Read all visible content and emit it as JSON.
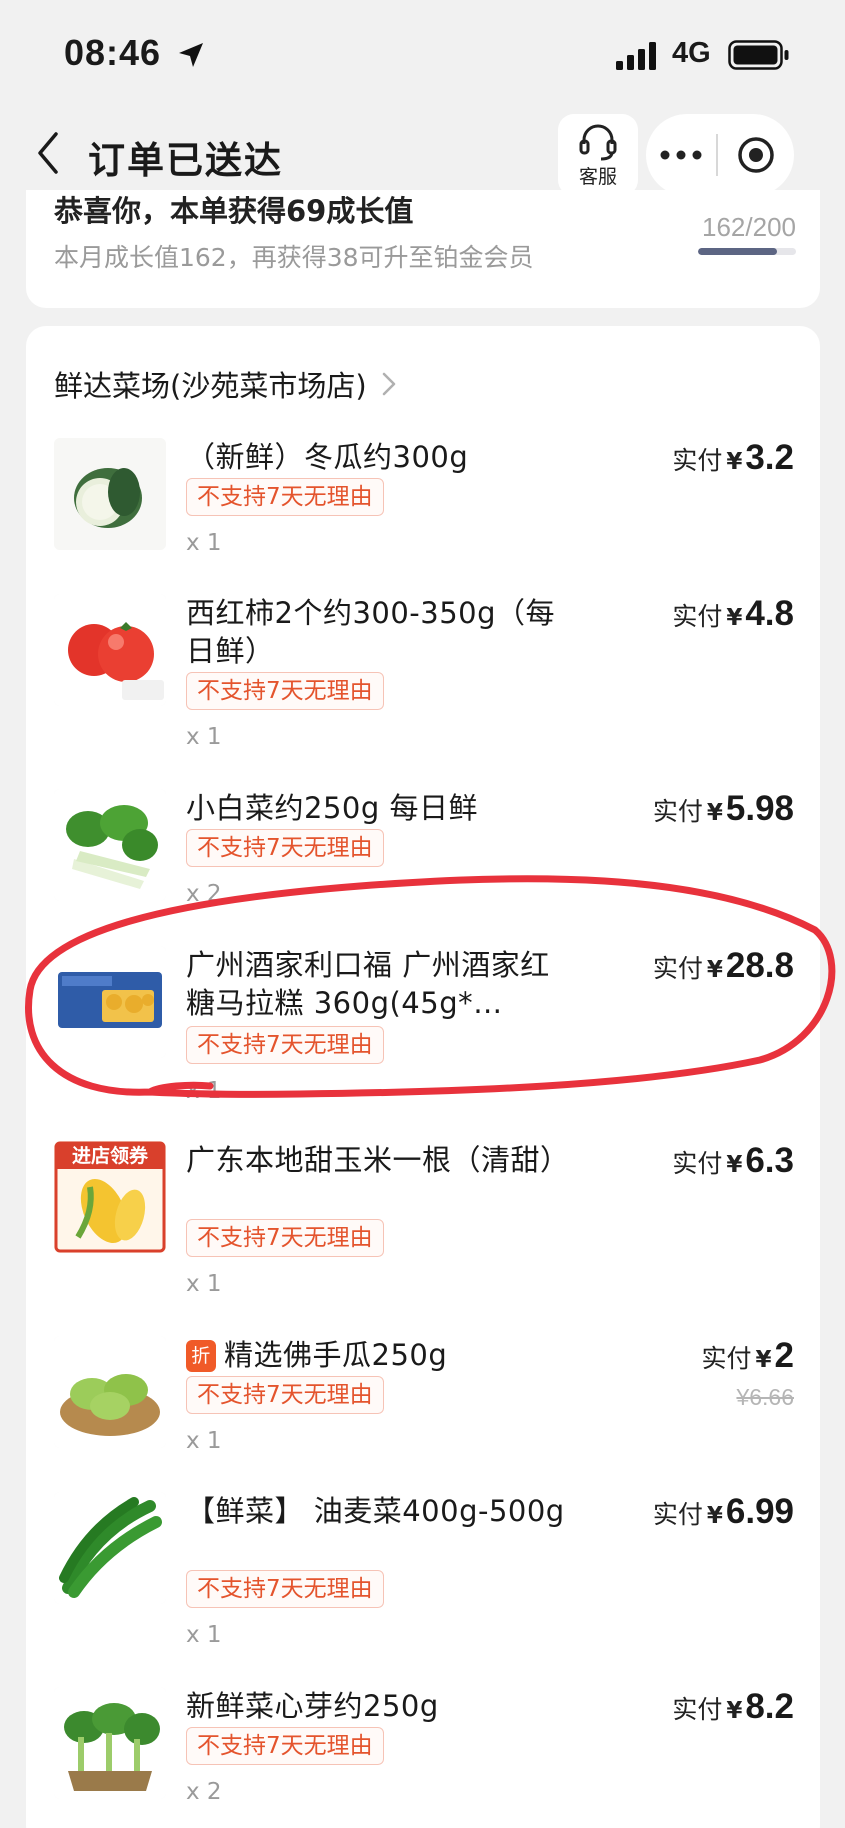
{
  "status_bar": {
    "time": "08:46",
    "network": "4G"
  },
  "nav": {
    "title": "订单已送达",
    "service_label": "客服"
  },
  "growth": {
    "headline": "恭喜你，本单获得69成长值",
    "subtext": "本月成长值162，再获得38可升至铂金会员",
    "progress_text": "162/200",
    "progress_fraction": 0.81
  },
  "shop": {
    "name": "鲜达菜场(沙苑菜市场店)"
  },
  "labels": {
    "paid": "实付",
    "currency": "¥",
    "no_return": "不支持7天无理由",
    "promo": "折"
  },
  "items": [
    {
      "title": "（新鲜）冬瓜约300g",
      "qty": "x 1",
      "price": "3.2",
      "image": "winter-melon"
    },
    {
      "title": "西红柿2个约300-350g（每日鲜）",
      "qty": "x 1",
      "price": "4.8",
      "image": "tomato"
    },
    {
      "title": "小白菜约250g 每日鲜",
      "qty": "x 2",
      "price": "5.98",
      "image": "bok-choy"
    },
    {
      "title": "广州酒家利口福 广州酒家红糖马拉糕 360g(45g*…",
      "qty": "x 1",
      "price": "28.8",
      "image": "sponge-cake-pack"
    },
    {
      "title": "广东本地甜玉米一根（清甜）",
      "qty": "x 1",
      "price": "6.3",
      "image": "sweet-corn",
      "image_badge": "进店领券"
    },
    {
      "title": "精选佛手瓜250g",
      "qty": "x 1",
      "price": "2",
      "original_price": "¥6.66",
      "image": "chayote",
      "promo": true
    },
    {
      "title": "【鲜菜】 油麦菜400g-500g",
      "qty": "x 1",
      "price": "6.99",
      "image": "lettuce"
    },
    {
      "title": "新鲜菜心芽约250g",
      "qty": "x 2",
      "price": "8.2",
      "image": "choy-sum"
    }
  ],
  "colors": {
    "background": "#f1f1f1",
    "badge_text": "#e4542d",
    "badge_border": "#f6c3b6",
    "promo_tag": "#f05a28",
    "progress_fill": "#5c6583",
    "annotation": "#e8323c"
  }
}
